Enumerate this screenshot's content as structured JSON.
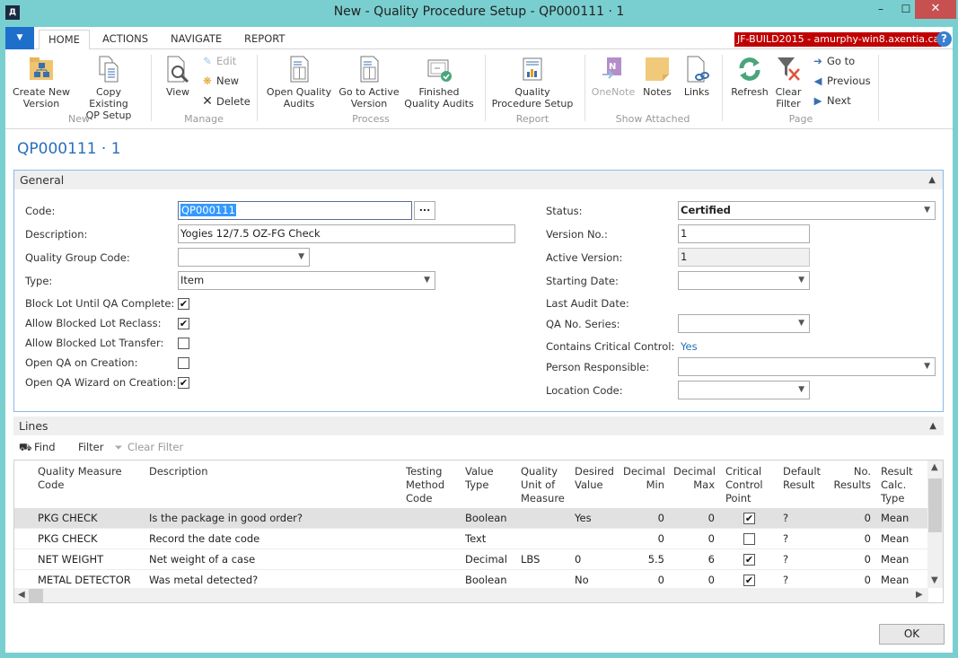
{
  "window": {
    "title": "New - Quality Procedure Setup - QP000111 · 1",
    "minimize": "–",
    "maximize": "☐",
    "close": "✕",
    "logo": "/\\"
  },
  "tabs": [
    {
      "label": "HOME",
      "active": true
    },
    {
      "label": "ACTIONS"
    },
    {
      "label": "NAVIGATE"
    },
    {
      "label": "REPORT"
    }
  ],
  "server_badge": "JF-BUILD2015 - amurphy-win8.axentia.ca",
  "help": "?",
  "ribbon": {
    "groups": {
      "new": "New",
      "manage": "Manage",
      "process": "Process",
      "report": "Report",
      "show_attached": "Show Attached",
      "page": "Page"
    },
    "create_new_version": [
      "Create New",
      "Version"
    ],
    "copy_existing": [
      "Copy Existing",
      "QP Setup"
    ],
    "view": "View",
    "edit": "Edit",
    "new": "New",
    "delete": "Delete",
    "open_quality_audits": [
      "Open Quality",
      "Audits"
    ],
    "go_to_active_version": [
      "Go to Active",
      "Version"
    ],
    "finished_quality_audits": [
      "Finished",
      "Quality Audits"
    ],
    "quality_procedure_setup": [
      "Quality",
      "Procedure Setup"
    ],
    "onenote": "OneNote",
    "notes": "Notes",
    "links": "Links",
    "refresh": "Refresh",
    "clear_filter": [
      "Clear",
      "Filter"
    ],
    "go_to": "Go to",
    "previous": "Previous",
    "next": "Next"
  },
  "page_title": "QP000111 · 1",
  "general": {
    "header": "General",
    "code_label": "Code:",
    "code_value": "QP000111",
    "ellipsis": "...",
    "description_label": "Description:",
    "description_value": "Yogies 12/7.5 OZ-FG Check",
    "quality_group_code_label": "Quality Group Code:",
    "quality_group_code_value": "",
    "type_label": "Type:",
    "type_value": "Item",
    "block_lot_label": "Block Lot Until QA Complete:",
    "block_lot_checked": true,
    "allow_reclass_label": "Allow Blocked Lot Reclass:",
    "allow_reclass_checked": true,
    "allow_transfer_label": "Allow Blocked Lot Transfer:",
    "allow_transfer_checked": false,
    "open_qa_label": "Open QA on Creation:",
    "open_qa_checked": false,
    "open_qa_wizard_label": "Open QA Wizard on Creation:",
    "open_qa_wizard_checked": true,
    "status_label": "Status:",
    "status_value": "Certified",
    "version_no_label": "Version No.:",
    "version_no_value": "1",
    "active_version_label": "Active Version:",
    "active_version_value": "1",
    "starting_date_label": "Starting Date:",
    "starting_date_value": "",
    "last_audit_date_label": "Last Audit Date:",
    "qa_no_series_label": "QA No. Series:",
    "qa_no_series_value": "",
    "contains_critical_label": "Contains Critical Control:",
    "contains_critical_value": "Yes",
    "person_responsible_label": "Person Responsible:",
    "person_responsible_value": "",
    "location_code_label": "Location Code:",
    "location_code_value": ""
  },
  "lines": {
    "header": "Lines",
    "toolbar": {
      "find": "Find",
      "filter": "Filter",
      "clear_filter": "Clear Filter"
    },
    "columns": [
      [
        "Quality Measure",
        "Code"
      ],
      [
        "Description"
      ],
      [
        "Testing",
        "Method",
        "Code"
      ],
      [
        "Value",
        "Type"
      ],
      [
        "Quality",
        "Unit of",
        "Measure"
      ],
      [
        "Desired",
        "Value"
      ],
      [
        "Decimal",
        "Min"
      ],
      [
        "Decimal",
        "Max"
      ],
      [
        "Critical",
        "Control",
        "Point"
      ],
      [
        "Default",
        "Result"
      ],
      [
        "No.",
        "Results"
      ],
      [
        "Result",
        "Calc.",
        "Type"
      ]
    ],
    "rows": [
      {
        "code": "PKG CHECK",
        "description": "Is the package in good order?",
        "testing_method": "",
        "value_type": "Boolean",
        "uom": "",
        "desired": "Yes",
        "min": "0",
        "max": "0",
        "critical": true,
        "default_result": "?",
        "no_results": "0",
        "calc_type": "Mean",
        "selected": true
      },
      {
        "code": "PKG CHECK",
        "description": "Record the date code",
        "testing_method": "",
        "value_type": "Text",
        "uom": "",
        "desired": "",
        "min": "0",
        "max": "0",
        "critical": false,
        "default_result": "?",
        "no_results": "0",
        "calc_type": "Mean"
      },
      {
        "code": "NET WEIGHT",
        "description": "Net weight of a case",
        "testing_method": "",
        "value_type": "Decimal",
        "uom": "LBS",
        "desired": "0",
        "min": "5.5",
        "max": "6",
        "critical": true,
        "default_result": "?",
        "no_results": "0",
        "calc_type": "Mean"
      },
      {
        "code": "METAL DETECTOR",
        "description": "Was metal detected?",
        "testing_method": "",
        "value_type": "Boolean",
        "uom": "",
        "desired": "No",
        "min": "0",
        "max": "0",
        "critical": true,
        "default_result": "?",
        "no_results": "0",
        "calc_type": "Mean"
      }
    ]
  },
  "ok_label": "OK",
  "glyphs": {
    "check": "✔",
    "dropdown": "⌄",
    "collapse": "⌃"
  }
}
